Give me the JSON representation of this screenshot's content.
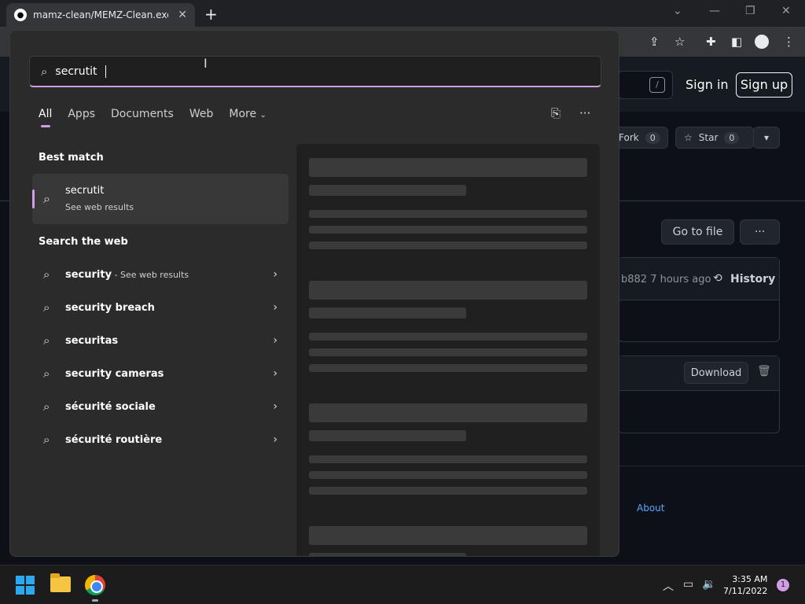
{
  "browser": {
    "tab_title": "mamz-clean/MEMZ-Clean.exe at",
    "tab_close": "✕",
    "new_tab": "+",
    "minimize": "—",
    "restore": "❐",
    "close": "✕",
    "tab_search": "⌄"
  },
  "github": {
    "search_shortcut": "/",
    "sign_in": "Sign in",
    "sign_up": "Sign up",
    "fork_label": "Fork",
    "fork_count": "0",
    "star_label": "Star",
    "star_count": "0",
    "go_to_file": "Go to file",
    "more_dots": "···",
    "commit_meta": "b882 7 hours ago",
    "history": "History",
    "download": "Download",
    "about": "About"
  },
  "search": {
    "query": "secrutit",
    "filters": [
      {
        "label": "All"
      },
      {
        "label": "Apps"
      },
      {
        "label": "Documents"
      },
      {
        "label": "Web"
      },
      {
        "label": "More"
      }
    ],
    "best_match_heading": "Best match",
    "best_match": {
      "title": "secrutit",
      "subtitle": "See web results"
    },
    "web_heading": "Search the web",
    "suggestions": [
      {
        "text": "security",
        "suffix": " - See web results"
      },
      {
        "text": "security breach",
        "suffix": ""
      },
      {
        "text": "securitas",
        "suffix": ""
      },
      {
        "text": "security cameras",
        "suffix": ""
      },
      {
        "text": "sécurité sociale",
        "suffix": ""
      },
      {
        "text": "sécurité routière",
        "suffix": ""
      }
    ]
  },
  "taskbar": {
    "time": "3:35 AM",
    "date": "7/11/2022",
    "notifications": "1"
  },
  "colors": {
    "accent": "#d19ee6",
    "flyout_bg": "#2b2b2b",
    "github_bg": "#0d1117"
  }
}
